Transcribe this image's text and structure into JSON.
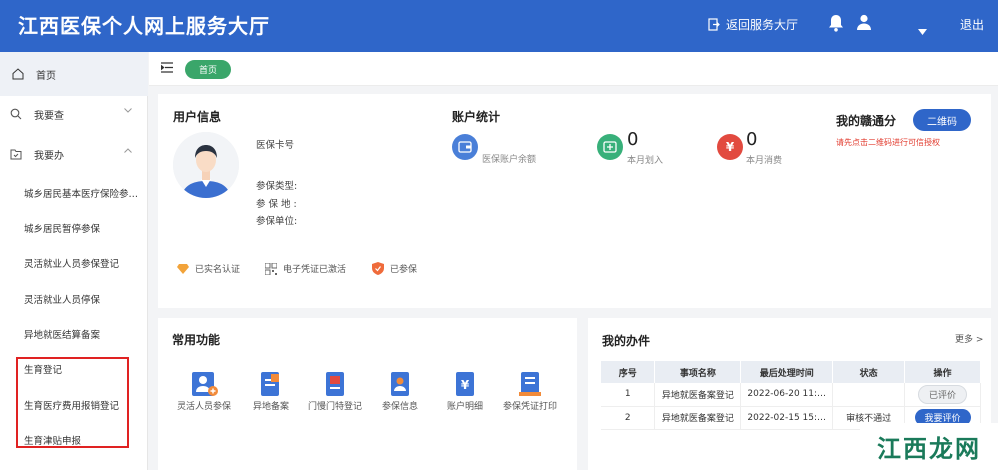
{
  "header": {
    "title": "江西医保个人网上服务大厅",
    "back_label": "返回服务大厅",
    "logout_label": "退出",
    "bell_icon": "bell-icon",
    "user_icon": "user-icon"
  },
  "sidebar": {
    "home": "首页",
    "query": "我要查",
    "handle": "我要办",
    "items": [
      "城乡居民基本医疗保险参…",
      "城乡居民暂停参保",
      "灵活就业人员参保登记",
      "灵活就业人员停保",
      "异地就医结算备案",
      "生育登记",
      "生育医疗费用报销登记",
      "生育津贴申报"
    ]
  },
  "breadcrumb": {
    "tag": "首页"
  },
  "user_info": {
    "title": "用户信息",
    "card_no_label": "医保卡号",
    "type_label": "参保类型:",
    "place_label": "参 保 地 :",
    "unit_label": "参保单位:",
    "badges": [
      "已实名认证",
      "电子凭证已激活",
      "已参保"
    ]
  },
  "account": {
    "title": "账户统计",
    "balance_label": "医保账户余额",
    "in_value": "0",
    "in_label": "本月划入",
    "out_value": "0",
    "out_label": "本月消费"
  },
  "mytong": {
    "title": "我的赣通分",
    "qr_button": "二维码",
    "warning": "请先点击二维码进行可信授权"
  },
  "functions": {
    "title": "常用功能",
    "items": [
      {
        "label": "灵活人员参保",
        "icon": "person-plus-icon"
      },
      {
        "label": "异地备案",
        "icon": "document-icon"
      },
      {
        "label": "门慢门特登记",
        "icon": "application-icon"
      },
      {
        "label": "参保信息",
        "icon": "id-card-icon"
      },
      {
        "label": "账户明细",
        "icon": "yen-icon"
      },
      {
        "label": "参保凭证打印",
        "icon": "print-certificate-icon"
      }
    ]
  },
  "tasks": {
    "title": "我的办件",
    "more": "更多 >",
    "headers": [
      "序号",
      "事项名称",
      "最后处理时间",
      "状态",
      "操作"
    ],
    "rows": [
      {
        "no": "1",
        "name": "异地就医备案登记",
        "time": "2022-06-20 11:…",
        "status": "",
        "action": "已评价"
      },
      {
        "no": "2",
        "name": "异地就医备案登记",
        "time": "2022-02-15 15:…",
        "status": "审核不通过",
        "action": "我要评价"
      }
    ]
  },
  "watermark": "江西龙网",
  "colors": {
    "primary": "#2f66c9",
    "green": "#3aa66a",
    "red": "#e02222"
  }
}
